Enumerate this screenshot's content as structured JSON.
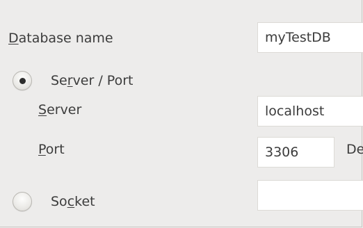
{
  "form": {
    "database_name": {
      "label_mnemonic": "D",
      "label_rest": "atabase name",
      "value": "myTestDB"
    },
    "server_port_option": {
      "label_pre": "Se",
      "label_mnemonic": "r",
      "label_post": "ver / Port",
      "selected": true
    },
    "server": {
      "label_mnemonic": "S",
      "label_rest": "erver",
      "value": "localhost"
    },
    "port": {
      "label_mnemonic": "P",
      "label_rest": "ort",
      "value": "3306",
      "trailing_text": "De"
    },
    "socket_option": {
      "label_pre": "So",
      "label_mnemonic": "c",
      "label_post": "ket",
      "selected": false,
      "value": ""
    }
  }
}
